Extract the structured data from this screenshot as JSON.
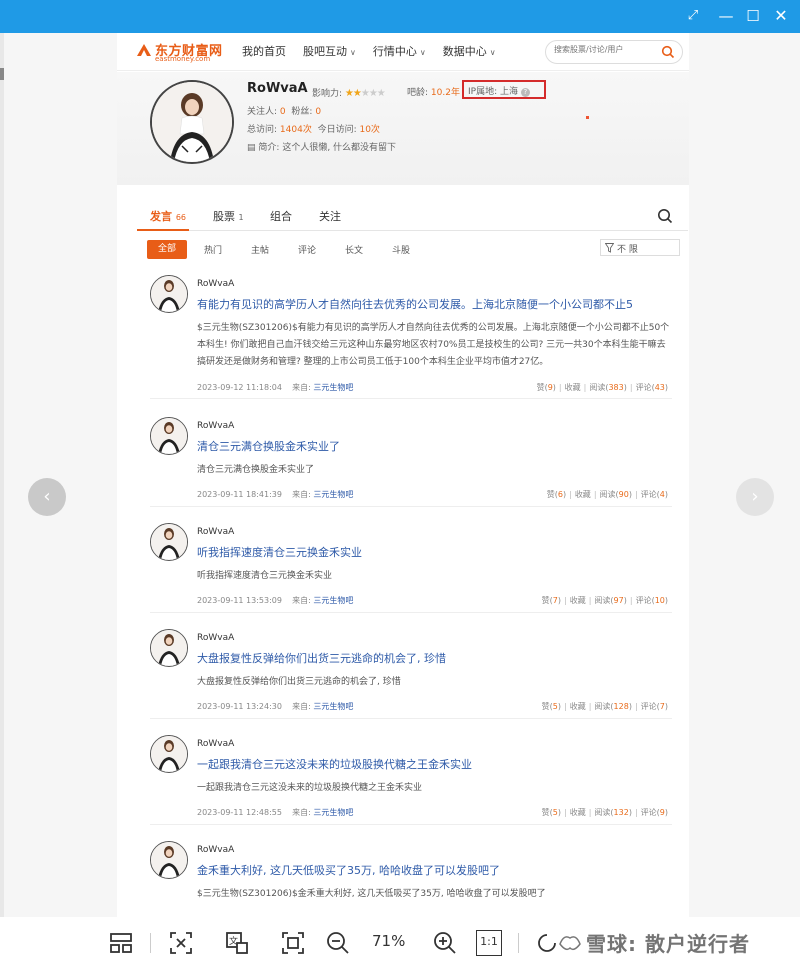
{
  "window": {
    "controls": [
      "pin",
      "minimize",
      "maximize",
      "close"
    ]
  },
  "site": {
    "logo_cn": "东方财富网",
    "logo_en": "eastmoney.com",
    "nav": [
      {
        "label": "我的首页",
        "has_dropdown": false
      },
      {
        "label": "股吧互动",
        "has_dropdown": true
      },
      {
        "label": "行情中心",
        "has_dropdown": true
      },
      {
        "label": "数据中心",
        "has_dropdown": true
      }
    ],
    "search_placeholder": "搜索股票/讨论/用户"
  },
  "profile": {
    "name": "RoWvaA",
    "influence_label": "影响力:",
    "influence_stars": 2,
    "influence_max": 5,
    "age_label": "吧龄:",
    "age_value": "10.2年",
    "ip_label": "IP属地: 上海",
    "followers_label": "关注人:",
    "followers_value": "0",
    "fans_label": "粉丝:",
    "fans_value": "0",
    "total_visits_label": "总访问:",
    "total_visits_value": "1404次",
    "today_visits_label": "今日访问:",
    "today_visits_value": "10次",
    "bio_label": "简介:",
    "bio_value": "这个人很懒, 什么都没有留下"
  },
  "tabs": [
    {
      "label": "发言",
      "count": "66",
      "active": true
    },
    {
      "label": "股票",
      "count": "1",
      "active": false
    },
    {
      "label": "组合",
      "count": "",
      "active": false
    },
    {
      "label": "关注",
      "count": "",
      "active": false
    }
  ],
  "filters": [
    "全部",
    "热门",
    "主帖",
    "评论",
    "长文",
    "斗股"
  ],
  "filter_select": "不 限",
  "posts": [
    {
      "author": "RoWvaA",
      "title": "有能力有见识的高学历人才自然向往去优秀的公司发展。上海北京随便一个小公司都不止5",
      "body": "$三元生物(SZ301206)$有能力有见识的高学历人才自然向往去优秀的公司发展。上海北京随便一个小公司都不止50个本科生! 你们敢把自己血汗钱交给三元这种山东最穷地区农村70%员工是技校生的公司? 三元一共30个本科生能干嘛去搞研发还是做财务和管理? 整理的上市公司员工低于100个本科生企业平均市值才27亿。",
      "time": "2023-09-12 11:18:04",
      "source_label": "来自:",
      "source": "三元生物吧",
      "likes": "9",
      "fav": "收藏",
      "reads": "383",
      "comments": "43"
    },
    {
      "author": "RoWvaA",
      "title": "清仓三元满仓换股金禾实业了",
      "body": "清仓三元满仓换股金禾实业了",
      "time": "2023-09-11 18:41:39",
      "source_label": "来自:",
      "source": "三元生物吧",
      "likes": "6",
      "fav": "收藏",
      "reads": "90",
      "comments": "4"
    },
    {
      "author": "RoWvaA",
      "title": "听我指挥速度清仓三元换金禾实业",
      "body": "听我指挥速度清仓三元换金禾实业",
      "time": "2023-09-11 13:53:09",
      "source_label": "来自:",
      "source": "三元生物吧",
      "likes": "7",
      "fav": "收藏",
      "reads": "97",
      "comments": "10"
    },
    {
      "author": "RoWvaA",
      "title": "大盘报复性反弹给你们出货三元逃命的机会了, 珍惜",
      "body": "大盘报复性反弹给你们出货三元逃命的机会了, 珍惜",
      "time": "2023-09-11 13:24:30",
      "source_label": "来自:",
      "source": "三元生物吧",
      "likes": "5",
      "fav": "收藏",
      "reads": "128",
      "comments": "7"
    },
    {
      "author": "RoWvaA",
      "title": "一起跟我清仓三元这没未来的垃圾股换代糖之王金禾实业",
      "body": "一起跟我清仓三元这没未来的垃圾股换代糖之王金禾实业",
      "time": "2023-09-11 12:48:55",
      "source_label": "来自:",
      "source": "三元生物吧",
      "likes": "5",
      "fav": "收藏",
      "reads": "132",
      "comments": "9"
    },
    {
      "author": "RoWvaA",
      "title": "金禾重大利好, 这几天低吸买了35万, 哈哈收盘了可以发股吧了",
      "body": "$三元生物(SZ301206)$金禾重大利好, 这几天低吸买了35万, 哈哈收盘了可以发股吧了",
      "time": "",
      "source_label": "",
      "source": "",
      "likes": "",
      "fav": "",
      "reads": "",
      "comments": ""
    }
  ],
  "labels": {
    "like": "赞",
    "read": "阅读",
    "comment": "评论"
  },
  "viewer": {
    "zoom": "71%",
    "actual_size": "1:1",
    "watermark": "雪球: 散户逆行者"
  },
  "colors": {
    "titlebar": "#1f9ae6",
    "accent": "#e85d17",
    "link": "#2e5aa8",
    "highlight_box": "#d42b2b"
  }
}
